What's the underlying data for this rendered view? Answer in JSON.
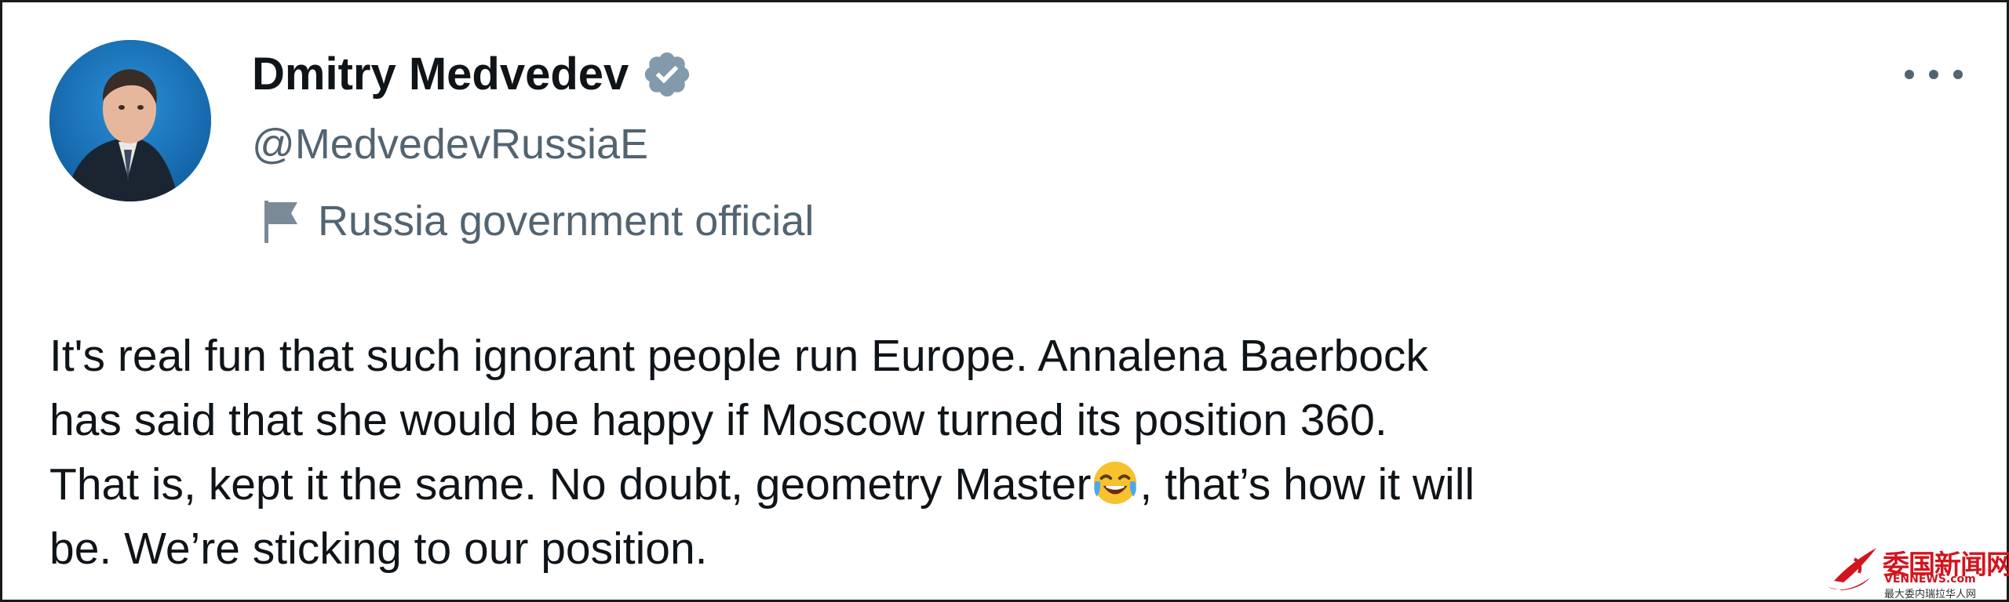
{
  "author": {
    "name": "Dmitry Medvedev",
    "handle": "@MedvedevRussiaE",
    "verified_icon": "verified-badge-icon",
    "affiliation_icon": "flag-icon",
    "affiliation_label": "Russia government official",
    "avatar": "profile-photo"
  },
  "menu": {
    "more_icon": "more-options-icon"
  },
  "tweet": {
    "lines": [
      "It's real fun that such ignorant people run Europe. Annalena Baerbock",
      "has said that she would be happy if Moscow turned its position 360.",
      "That is, kept it the same. No doubt, geometry Master",
      ", that’s how it will",
      "be. We’re sticking to our position."
    ],
    "emoji": "face-with-tears-of-joy-icon"
  },
  "watermark": {
    "brand_cn": "委国新闻网",
    "url": "VENNEWS.com",
    "tagline": "最大委内瑞拉华人网"
  },
  "colors": {
    "text_primary": "#0f1419",
    "text_secondary": "#536471",
    "verified_badge": "#829aab",
    "watermark_red": "#d2141e"
  }
}
